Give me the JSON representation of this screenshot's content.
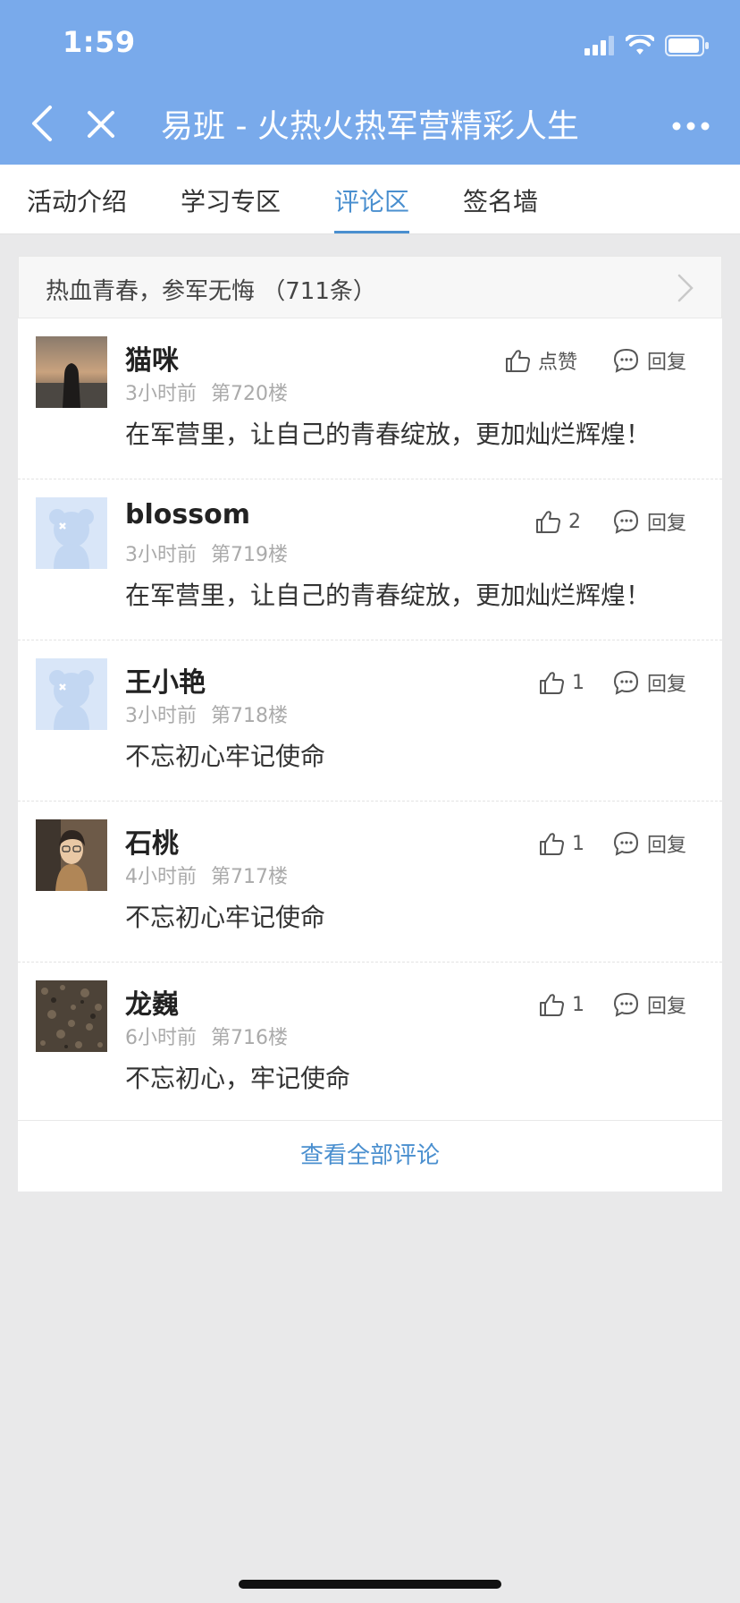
{
  "status_bar": {
    "time": "1:59"
  },
  "nav": {
    "title": "易班 - 火热火热军营精彩人生"
  },
  "tabs": [
    {
      "label": "活动介绍",
      "active": false
    },
    {
      "label": "学习专区",
      "active": false
    },
    {
      "label": "评论区",
      "active": true
    },
    {
      "label": "签名墙",
      "active": false
    }
  ],
  "topic": {
    "title": "热血青春，参军无悔 （711条）"
  },
  "comments": [
    {
      "user": "猫咪",
      "time": "3小时前",
      "floor": "第720楼",
      "text": "在军营里，让自己的青春绽放，更加灿烂辉煌！",
      "like": "点赞",
      "reply": "回复",
      "avatar": "photo-sunset"
    },
    {
      "user": "blossom",
      "time": "3小时前",
      "floor": "第719楼",
      "text": "在军营里，让自己的青春绽放，更加灿烂辉煌！",
      "like": "2",
      "reply": "回复",
      "avatar": "default-bear"
    },
    {
      "user": "王小艳",
      "time": "3小时前",
      "floor": "第718楼",
      "text": "不忘初心牢记使命",
      "like": "1",
      "reply": "回复",
      "avatar": "default-bear"
    },
    {
      "user": "石桃",
      "time": "4小时前",
      "floor": "第717楼",
      "text": "不忘初心牢记使命",
      "like": "1",
      "reply": "回复",
      "avatar": "photo-portrait"
    },
    {
      "user": "龙巍",
      "time": "6小时前",
      "floor": "第716楼",
      "text": "不忘初心，牢记使命",
      "like": "1",
      "reply": "回复",
      "avatar": "photo-texture"
    }
  ],
  "footer": {
    "view_all": "查看全部评论"
  },
  "colors": {
    "header_bg": "#79aaeb",
    "accent": "#4a8fcf",
    "page_bg": "#e9e9ea"
  }
}
